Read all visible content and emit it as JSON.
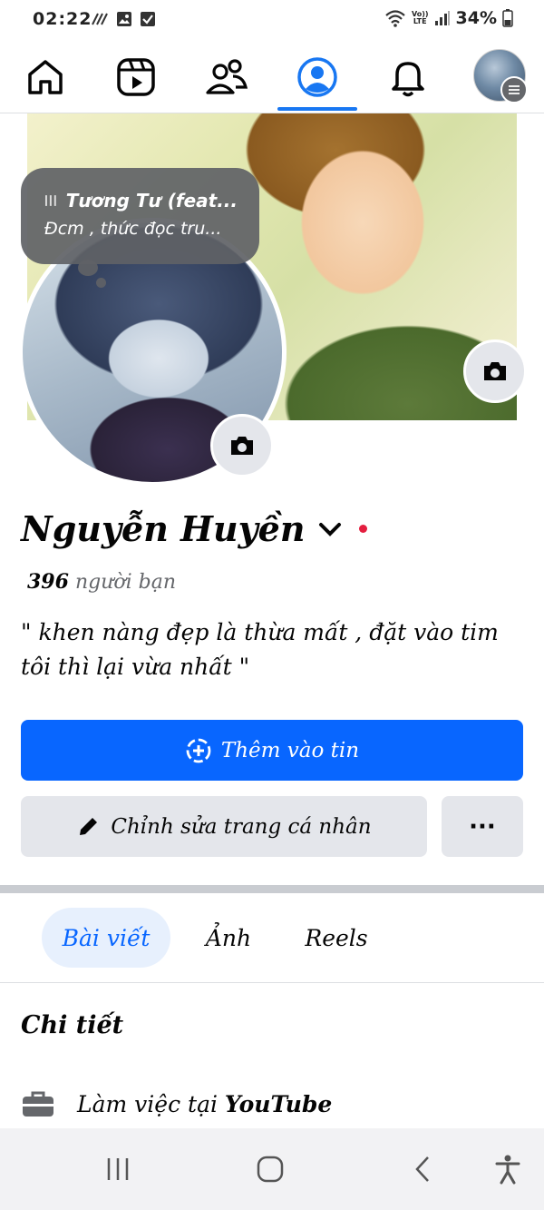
{
  "status_bar": {
    "time": "02:22",
    "lte_top": "Vo))",
    "lte_bottom": "LTE",
    "battery": "34%"
  },
  "nav": {
    "items": [
      "home-icon",
      "video-icon",
      "friends-icon",
      "profile-icon",
      "bell-icon"
    ],
    "active": "profile-icon",
    "accent": "#1877f2"
  },
  "note": {
    "song": "Tương Tư (feat...",
    "text": "Đcm , thức đọc tru..."
  },
  "profile": {
    "name": "Nguyễn Huyền",
    "friend_count": "396",
    "friends_label": "người bạn",
    "bio": "\" khen nàng đẹp là thừa mất , đặt vào tim tôi thì lại vừa nhất \""
  },
  "buttons": {
    "add_story": "Thêm vào tin",
    "edit_profile": "Chỉnh sửa trang cá nhân",
    "more": "···"
  },
  "tabs": [
    {
      "label": "Bài viết",
      "active": true
    },
    {
      "label": "Ảnh",
      "active": false
    },
    {
      "label": "Reels",
      "active": false
    }
  ],
  "details": {
    "title": "Chi tiết",
    "work_prefix": "Làm việc tại",
    "work_place": "YouTube"
  },
  "colors": {
    "primary": "#0866ff",
    "secondary_bg": "#e4e6eb",
    "online_dot": "#e41e3f"
  }
}
